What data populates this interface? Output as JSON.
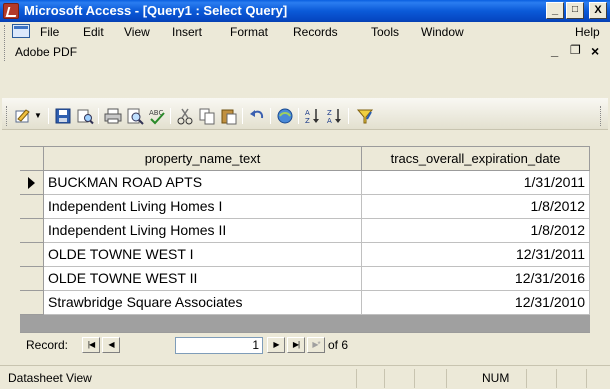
{
  "window": {
    "title": "Microsoft Access - [Query1 : Select Query]",
    "minimize": "_",
    "restore": "□",
    "close": "X"
  },
  "menu": {
    "items": [
      "File",
      "Edit",
      "View",
      "Insert",
      "Format",
      "Records",
      "Tools",
      "Window",
      "Help"
    ],
    "adobe_pdf": "Adobe PDF",
    "doc_minimize": "_",
    "doc_restore": "❐",
    "doc_close": "×"
  },
  "toolbar": {
    "icons": [
      "design-view-icon",
      "dropdown-arrow-icon",
      "save-icon",
      "file-search-icon",
      "print-icon",
      "print-preview-icon",
      "spelling-icon",
      "cut-icon",
      "copy-icon",
      "paste-icon",
      "undo-icon",
      "insert-hyperlink-icon",
      "sort-ascending-icon",
      "sort-descending-icon",
      "filter-by-selection-icon"
    ]
  },
  "grid": {
    "columns": [
      "property_name_text",
      "tracs_overall_expiration_date"
    ],
    "rows": [
      {
        "property_name_text": "BUCKMAN ROAD APTS",
        "tracs_overall_expiration_date": "1/31/2011"
      },
      {
        "property_name_text": "Independent Living Homes I",
        "tracs_overall_expiration_date": "1/8/2012"
      },
      {
        "property_name_text": "Independent Living Homes II",
        "tracs_overall_expiration_date": "1/8/2012"
      },
      {
        "property_name_text": "OLDE TOWNE WEST I",
        "tracs_overall_expiration_date": "12/31/2011"
      },
      {
        "property_name_text": "OLDE TOWNE WEST II",
        "tracs_overall_expiration_date": "12/31/2016"
      },
      {
        "property_name_text": "Strawbridge Square Associates",
        "tracs_overall_expiration_date": "12/31/2010"
      }
    ],
    "current_row": 0
  },
  "record_nav": {
    "label": "Record:",
    "current": "1",
    "of_text": "of 6"
  },
  "status": {
    "view": "Datasheet View",
    "num": "NUM"
  },
  "colors": {
    "titlebar": "#0b5ad8",
    "chrome": "#ece9d8"
  }
}
